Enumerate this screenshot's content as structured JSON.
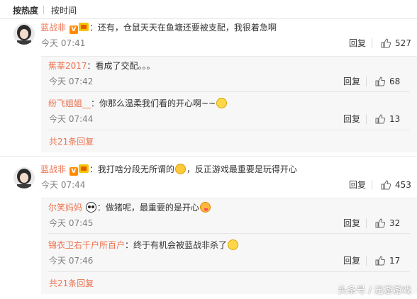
{
  "sort": {
    "hot_label": "按热度",
    "time_label": "按时间"
  },
  "comments": [
    {
      "username": "蓝战非",
      "text": "：还有，仓鼠天天在鱼塘还要被支配，我很着急啊",
      "time": "今天 07:41",
      "reply_label": "回复",
      "likes": "527",
      "replies": [
        {
          "username": "蕉莘2017",
          "text": "：看成了交配。。。",
          "time": "今天 07:42",
          "reply_label": "回复",
          "likes": "68"
        },
        {
          "username": "纷飞姐姐__",
          "text": "：你那么温柔我们看的开心啊~~",
          "time": "今天 07:44",
          "reply_label": "回复",
          "likes": "13"
        }
      ],
      "more_replies": "共21条回复"
    },
    {
      "username": "蓝战非",
      "text_before_emoji": "：我打啥分段无所谓的",
      "text_after_emoji": "，反正游戏最重要是玩得开心",
      "time": "今天 07:44",
      "reply_label": "回复",
      "likes": "453",
      "replies": [
        {
          "username": "尔笑妈妈",
          "text": "：做猪呢，最重要的是开心",
          "time": "今天 07:45",
          "reply_label": "回复",
          "likes": "32"
        },
        {
          "username": "锦衣卫右千户所百户",
          "text": "：终于有机会被蓝战非杀了",
          "time": "今天 07:46",
          "reply_label": "回复",
          "likes": "17"
        }
      ],
      "more_replies": "共21条回复"
    }
  ],
  "icons": {
    "like": "thumbs-up-icon",
    "verified": "v-badge-icon",
    "level": "level-badge-icon"
  },
  "colors": {
    "username": "#eb7350",
    "time": "#808080",
    "sub_bg": "#f7f7f7"
  },
  "watermark": "头条号 / 迅游游戏"
}
